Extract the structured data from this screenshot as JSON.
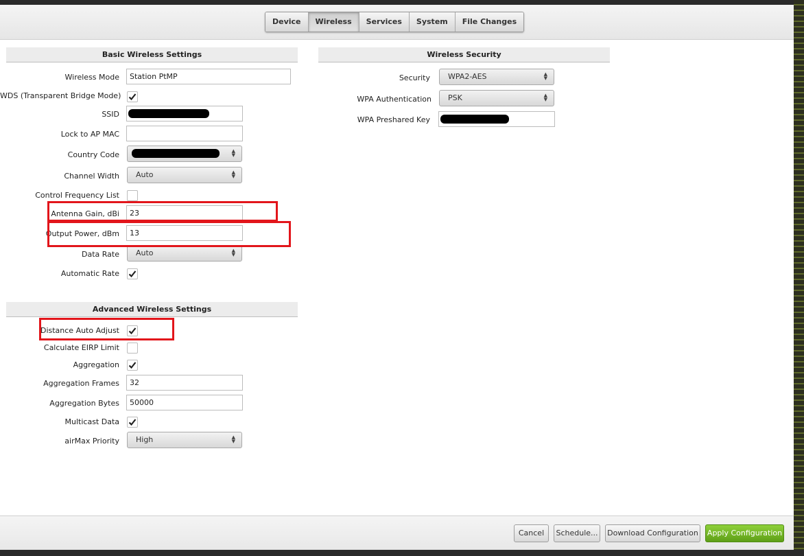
{
  "tabs": [
    "Device",
    "Wireless",
    "Services",
    "System",
    "File Changes"
  ],
  "active_tab": "Wireless",
  "basic": {
    "title": "Basic Wireless Settings",
    "wireless_mode": {
      "label": "Wireless Mode",
      "value": "Station PtMP"
    },
    "wds": {
      "label": "WDS (Transparent Bridge Mode)",
      "checked": true
    },
    "ssid": {
      "label": "SSID",
      "value": ""
    },
    "lock_ap_mac": {
      "label": "Lock to AP MAC",
      "value": ""
    },
    "country_code": {
      "label": "Country Code",
      "value": ""
    },
    "channel_width": {
      "label": "Channel Width",
      "value": "Auto"
    },
    "control_freq": {
      "label": "Control Frequency List",
      "checked": false
    },
    "antenna_gain": {
      "label": "Antenna Gain, dBi",
      "value": "23"
    },
    "output_power": {
      "label": "Output Power, dBm",
      "value": "13"
    },
    "data_rate": {
      "label": "Data Rate",
      "value": "Auto"
    },
    "auto_rate": {
      "label": "Automatic Rate",
      "checked": true
    }
  },
  "advanced": {
    "title": "Advanced Wireless Settings",
    "distance_auto": {
      "label": "Distance Auto Adjust",
      "checked": true
    },
    "calc_eirp": {
      "label": "Calculate EIRP Limit",
      "checked": false
    },
    "aggregation": {
      "label": "Aggregation",
      "checked": true
    },
    "agg_frames": {
      "label": "Aggregation Frames",
      "value": "32"
    },
    "agg_bytes": {
      "label": "Aggregation Bytes",
      "value": "50000"
    },
    "multicast": {
      "label": "Multicast Data",
      "checked": true
    },
    "airmax": {
      "label": "airMax Priority",
      "value": "High"
    }
  },
  "security": {
    "title": "Wireless Security",
    "security": {
      "label": "Security",
      "value": "WPA2-AES"
    },
    "wpa_auth": {
      "label": "WPA Authentication",
      "value": "PSK"
    },
    "wpa_key": {
      "label": "WPA Preshared Key",
      "value": ""
    }
  },
  "footer": {
    "cancel": "Cancel",
    "schedule": "Schedule...",
    "download": "Download Configuration",
    "apply": "Apply Configuration"
  },
  "colors": {
    "highlight": "#e2151b",
    "apply_button": "#6fb224"
  }
}
